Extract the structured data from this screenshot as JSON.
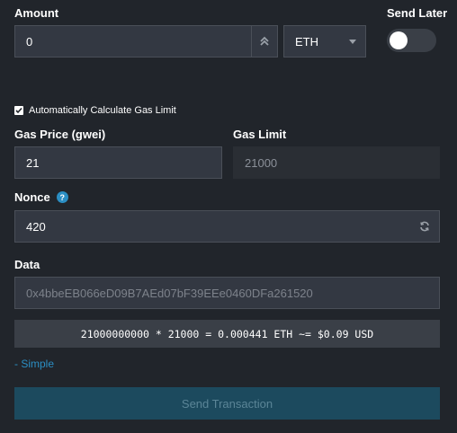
{
  "amount": {
    "label": "Amount",
    "value": "0",
    "currency": "ETH"
  },
  "send_later": {
    "label": "Send Later",
    "enabled": false
  },
  "auto_gas": {
    "label": "Automatically Calculate Gas Limit",
    "checked": true
  },
  "gas_price": {
    "label": "Gas Price (gwei)",
    "value": "21"
  },
  "gas_limit": {
    "label": "Gas Limit",
    "value": "21000"
  },
  "nonce": {
    "label": "Nonce",
    "help_glyph": "?",
    "value": "420"
  },
  "data_field": {
    "label": "Data",
    "value": "0x4bbeEB066eD09B7AEd07bF39EEe0460DFa261520"
  },
  "summary": "21000000000 * 21000 = 0.000441 ETH ~= $0.09 USD",
  "simple_link": "- Simple",
  "send_button": "Send Transaction",
  "colors": {
    "background": "#21252b",
    "input_bg": "#333842",
    "accent": "#2b8ec3",
    "send_button_bg": "#1c4a5e"
  }
}
